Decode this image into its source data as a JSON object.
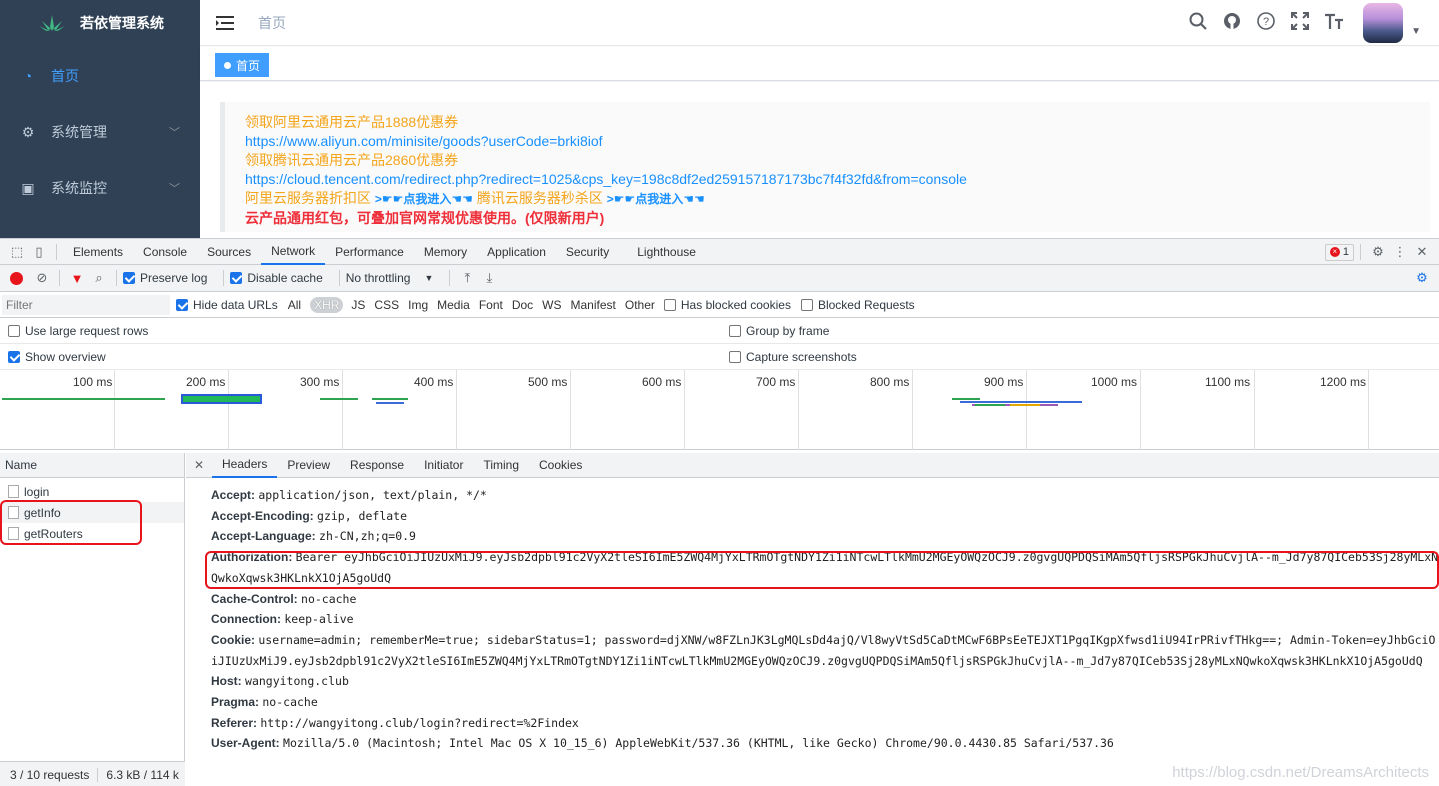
{
  "app": {
    "title": "若依管理系统"
  },
  "sidebar": {
    "items": [
      {
        "label": "首页",
        "icon": "dashboard-icon",
        "active": true
      },
      {
        "label": "系统管理",
        "icon": "gear-icon",
        "active": false
      },
      {
        "label": "系统监控",
        "icon": "monitor-icon",
        "active": false
      }
    ]
  },
  "navbar": {
    "breadcrumb": "首页",
    "icons": [
      "search-icon",
      "github-icon",
      "question-icon",
      "fullscreen-icon",
      "font-size-icon"
    ]
  },
  "tags": {
    "active": "首页"
  },
  "notice": {
    "line1": "领取阿里云通用云产品1888优惠券",
    "line2": "https://www.aliyun.com/minisite/goods?userCode=brki8iof",
    "line3": "领取腾讯云通用云产品2860优惠券",
    "line4": "https://cloud.tencent.com/redirect.php?redirect=1025&cps_key=198c8df2ed259157187173bc7f4f32fd&from=console",
    "line5a": "阿里云服务器折扣区",
    "line5b": ">☛☛点我进入☚☚",
    "line5c": "腾讯云服务器秒杀区",
    "line5d": ">☛☛点我进入☚☚",
    "line6": "云产品通用红包，可叠加官网常规优惠使用。(仅限新用户)"
  },
  "devtools": {
    "tabs": [
      "Elements",
      "Console",
      "Sources",
      "Network",
      "Performance",
      "Memory",
      "Application",
      "Security",
      "Lighthouse"
    ],
    "active_tab": "Network",
    "error_count": "1",
    "toolbar": {
      "preserve_log": "Preserve log",
      "disable_cache": "Disable cache",
      "throttling": "No throttling"
    },
    "filter": {
      "placeholder": "Filter",
      "hide_data_urls": "Hide data URLs",
      "types": [
        "All",
        "XHR",
        "JS",
        "CSS",
        "Img",
        "Media",
        "Font",
        "Doc",
        "WS",
        "Manifest",
        "Other"
      ],
      "active_type": "XHR",
      "has_blocked": "Has blocked cookies",
      "blocked_requests": "Blocked Requests"
    },
    "options": {
      "large_rows": "Use large request rows",
      "show_overview": "Show overview",
      "group_by_frame": "Group by frame",
      "capture_screenshots": "Capture screenshots"
    },
    "timeline": [
      "100 ms",
      "200 ms",
      "300 ms",
      "400 ms",
      "500 ms",
      "600 ms",
      "700 ms",
      "800 ms",
      "900 ms",
      "1000 ms",
      "1100 ms",
      "1200 ms"
    ],
    "name_header": "Name",
    "requests": [
      "login",
      "getInfo",
      "getRouters"
    ],
    "status": "3 / 10 requests",
    "size": "6.3 kB / 114 k",
    "detail_tabs": [
      "Headers",
      "Preview",
      "Response",
      "Initiator",
      "Timing",
      "Cookies"
    ],
    "active_detail": "Headers",
    "headers": [
      {
        "k": "Accept:",
        "v": "application/json, text/plain, */*"
      },
      {
        "k": "Accept-Encoding:",
        "v": "gzip, deflate"
      },
      {
        "k": "Accept-Language:",
        "v": "zh-CN,zh;q=0.9"
      },
      {
        "k": "Authorization:",
        "v": "Bearer eyJhbGciOiJIUzUxMiJ9.eyJsb2dpbl91c2VyX2tleSI6ImE5ZWQ4MjYxLTRmOTgtNDY1Zi1iNTcwLTlkMmU2MGEyOWQzOCJ9.z0gvgUQPDQSiMAm5QfljsRSPGkJhuCvjlA--m_Jd7y87QICeb53Sj28yMLxNQwkoXqwsk3HKLnkX1OjA5goUdQ"
      },
      {
        "k": "Cache-Control:",
        "v": "no-cache"
      },
      {
        "k": "Connection:",
        "v": "keep-alive"
      },
      {
        "k": "Cookie:",
        "v": "username=admin; rememberMe=true; sidebarStatus=1; password=djXNW/w8FZLnJK3LgMQLsDd4ajQ/Vl8wyVtSd5CaDtMCwF6BPsEeTEJXT1PgqIKgpXfwsd1iU94IrPRivfTHkg==; Admin-Token=eyJhbGciOiJIUzUxMiJ9.eyJsb2dpbl91c2VyX2tleSI6ImE5ZWQ4MjYxLTRmOTgtNDY1Zi1iNTcwLTlkMmU2MGEyOWQzOCJ9.z0gvgUQPDQSiMAm5QfljsRSPGkJhuCvjlA--m_Jd7y87QICeb53Sj28yMLxNQwkoXqwsk3HKLnkX1OjA5goUdQ"
      },
      {
        "k": "Host:",
        "v": "wangyitong.club"
      },
      {
        "k": "Pragma:",
        "v": "no-cache"
      },
      {
        "k": "Referer:",
        "v": "http://wangyitong.club/login?redirect=%2Findex"
      },
      {
        "k": "User-Agent:",
        "v": "Mozilla/5.0 (Macintosh; Intel Mac OS X 10_15_6) AppleWebKit/537.36 (KHTML, like Gecko) Chrome/90.0.4430.85 Safari/537.36"
      }
    ]
  },
  "watermark": "https://blog.csdn.net/DreamsArchitects",
  "colors": {
    "sidebar": "#304156",
    "accent": "#409eff",
    "highlight": "#e8141c"
  }
}
